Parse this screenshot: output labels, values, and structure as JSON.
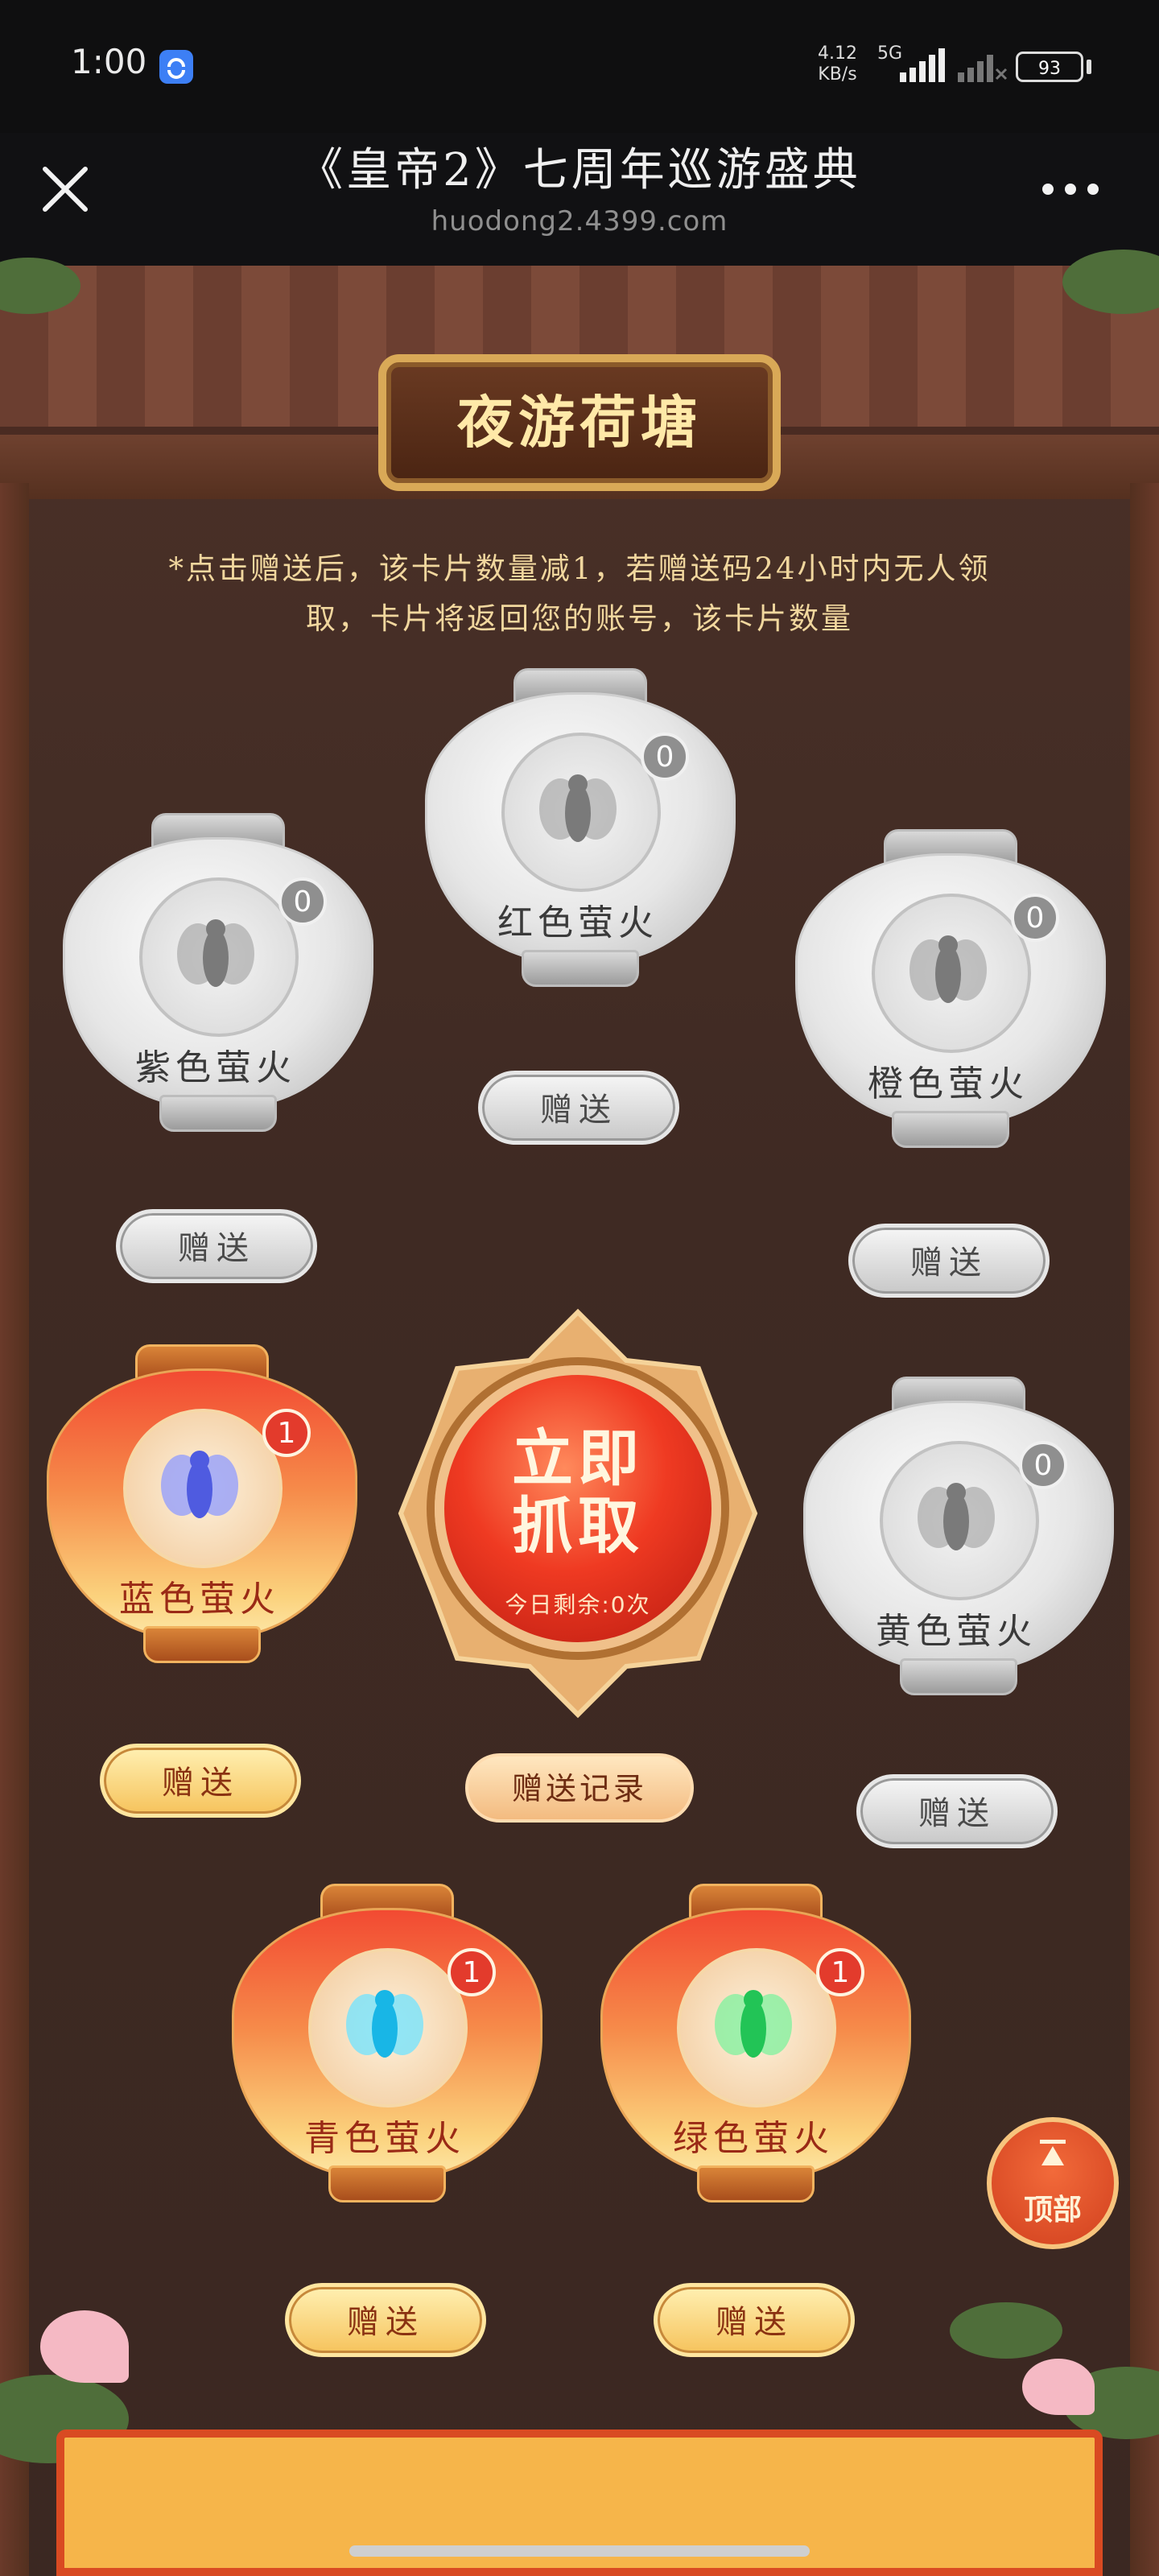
{
  "status_bar": {
    "time": "1:00",
    "net_speed_value": "4.12",
    "net_speed_unit": "KB/s",
    "network": "5G",
    "battery": "93"
  },
  "header": {
    "title": "《皇帝2》七周年巡游盛典",
    "url": "huodong2.4399.com",
    "close_icon": "close-icon",
    "more_icon": "more-icon"
  },
  "page": {
    "plaque_title": "夜游荷塘",
    "notice": "*点击赠送后，该卡片数量减1，若赠送码24小时内无人领取，卡片将返回您的账号，该卡片数量",
    "lanterns": [
      {
        "name": "紫色萤火",
        "count": "0",
        "state": "inactive",
        "fly_color": "#9a9a9a"
      },
      {
        "name": "红色萤火",
        "count": "0",
        "state": "inactive",
        "fly_color": "#9a9a9a"
      },
      {
        "name": "橙色萤火",
        "count": "0",
        "state": "inactive",
        "fly_color": "#9a9a9a"
      },
      {
        "name": "蓝色萤火",
        "count": "1",
        "state": "active",
        "fly_color": "#6f7bf2"
      },
      {
        "name": "黄色萤火",
        "count": "0",
        "state": "inactive",
        "fly_color": "#9a9a9a"
      },
      {
        "name": "青色萤火",
        "count": "1",
        "state": "active",
        "fly_color": "#2ec9f0"
      },
      {
        "name": "绿色萤火",
        "count": "1",
        "state": "active",
        "fly_color": "#37d56a"
      }
    ],
    "give_label": "赠送",
    "grab": {
      "label_line1": "立即",
      "label_line2": "抓取",
      "remaining": "今日剩余:0次"
    },
    "record_label": "赠送记录",
    "top_label": "顶部"
  },
  "colors": {
    "accent_red": "#ef3a22",
    "gold": "#f6c35c",
    "page_bg": "#3f2a23"
  }
}
